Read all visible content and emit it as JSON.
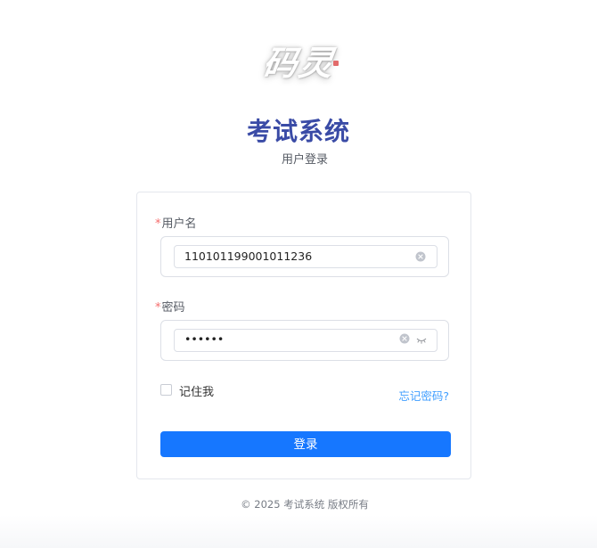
{
  "logo": {
    "text": "码灵",
    "seal_color": "#e26b6b"
  },
  "header": {
    "title": "考试系统",
    "subtitle": "用户登录",
    "title_color": "#3a4ba6"
  },
  "form": {
    "username": {
      "required_mark": "*",
      "label": "用户名",
      "value": "110101199001011236",
      "icon": "clear-icon"
    },
    "password": {
      "required_mark": "*",
      "label": "密码",
      "value": "••••••",
      "icons": [
        "clear-icon",
        "eye-closed-icon"
      ]
    },
    "remember": {
      "label": "记住我",
      "checked": false
    },
    "forgot_label": "忘记密码?",
    "submit_label": "登录",
    "accent_color": "#1677ff",
    "link_color": "#409eff"
  },
  "footer": {
    "copyright": "© 2025 考试系统 版权所有"
  }
}
